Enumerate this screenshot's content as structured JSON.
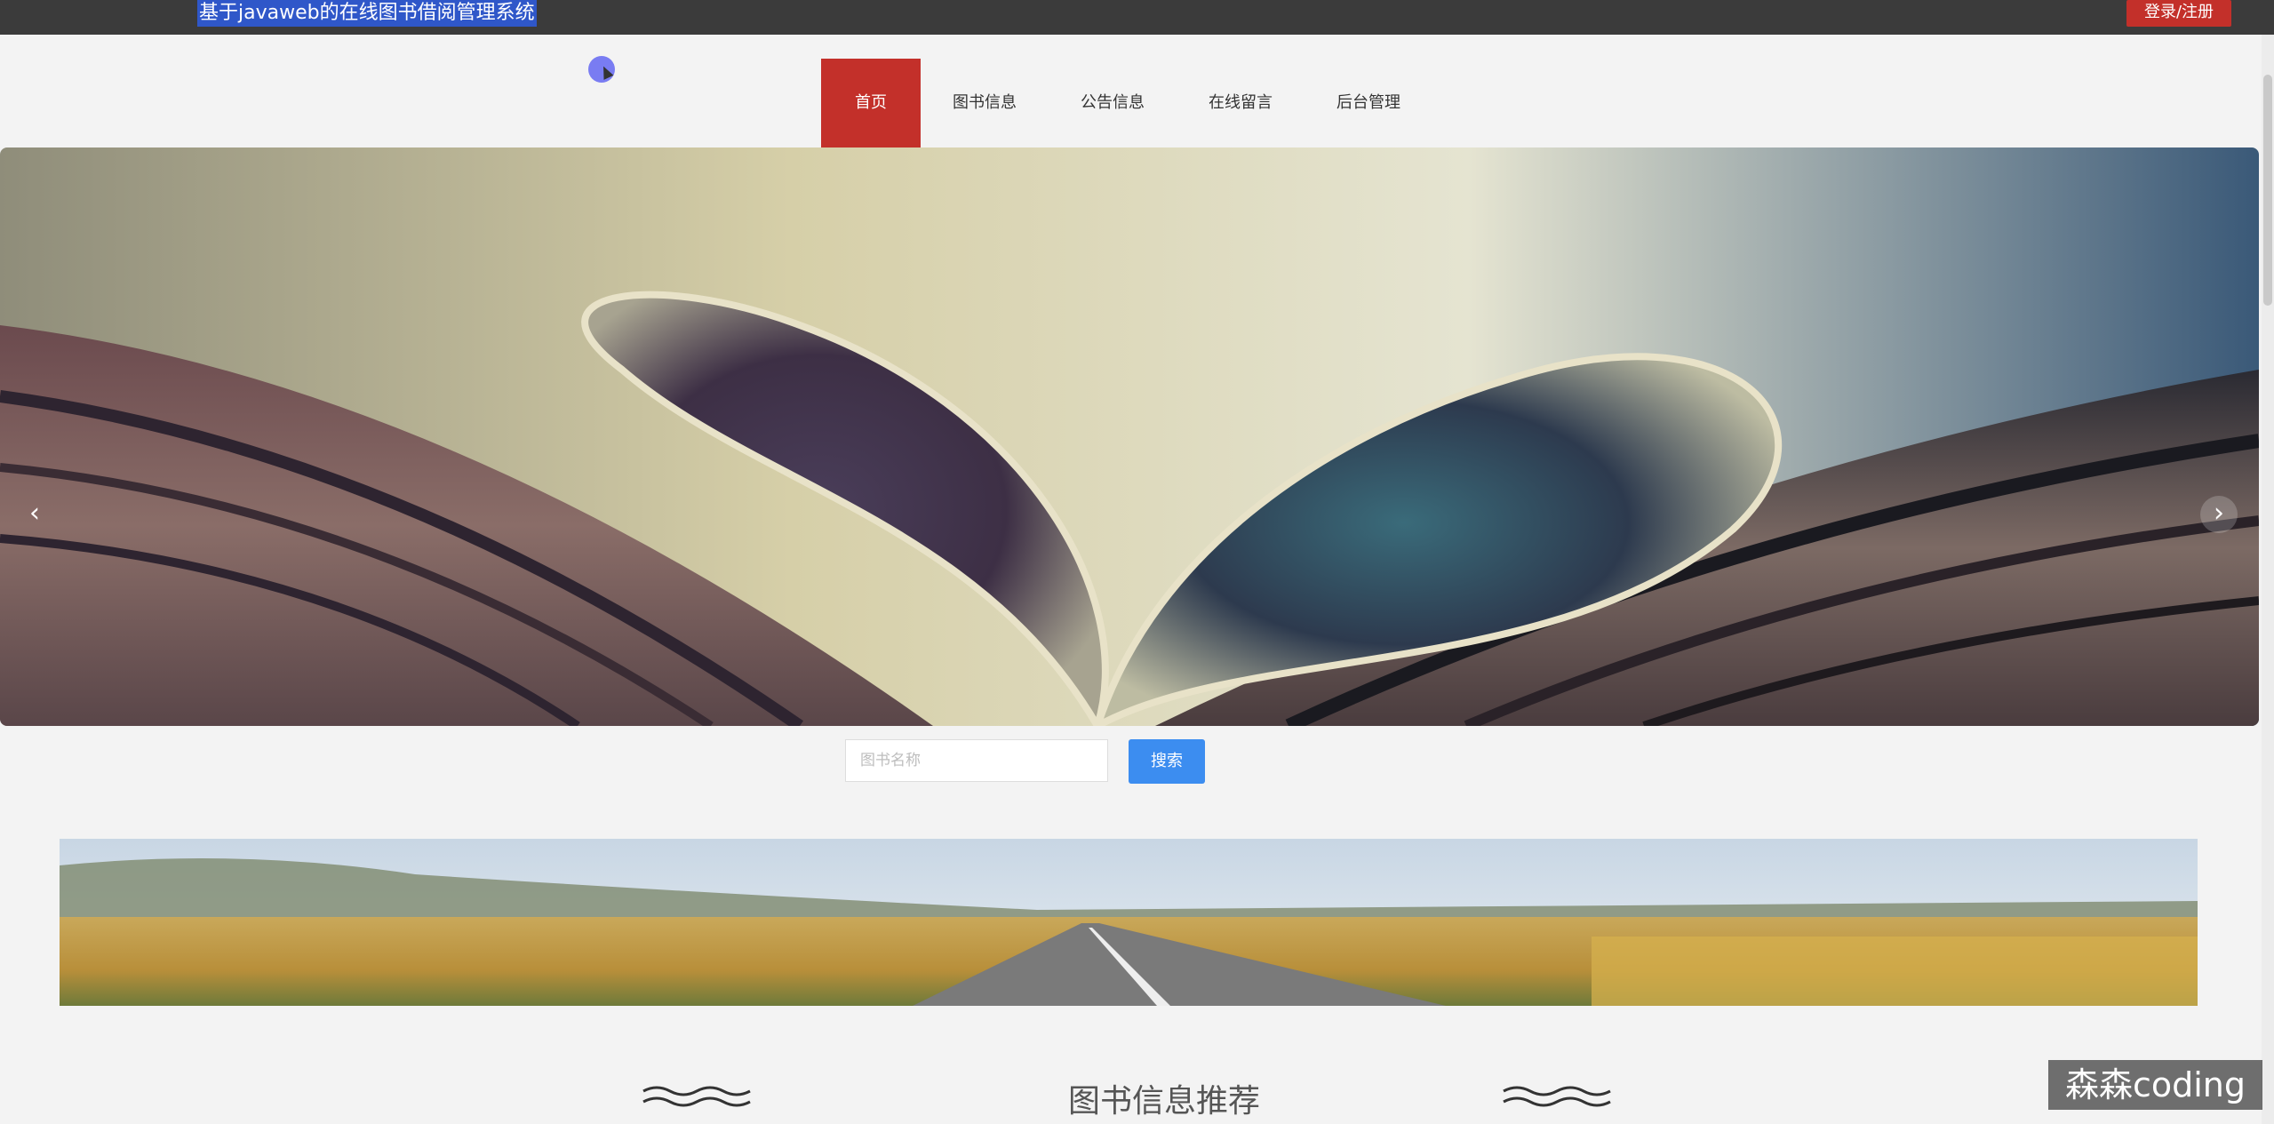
{
  "header": {
    "site_title": "基于javaweb的在线图书借阅管理系统",
    "login_label": "登录/注册"
  },
  "nav": {
    "items": [
      "首页",
      "图书信息",
      "公告信息",
      "在线留言",
      "后台管理"
    ],
    "active_index": 0
  },
  "banner": {
    "left_arrow": "‹",
    "right_arrow": "›",
    "slides": 3,
    "active_slide": 0
  },
  "search": {
    "placeholder": "图书名称",
    "button_label": "搜索"
  },
  "section": {
    "title": "图书信息推荐"
  },
  "watermark": "森森coding",
  "colors": {
    "topbar": "#3b3b3b",
    "accent_red": "#c3302a",
    "search_blue": "#3c8df0"
  }
}
